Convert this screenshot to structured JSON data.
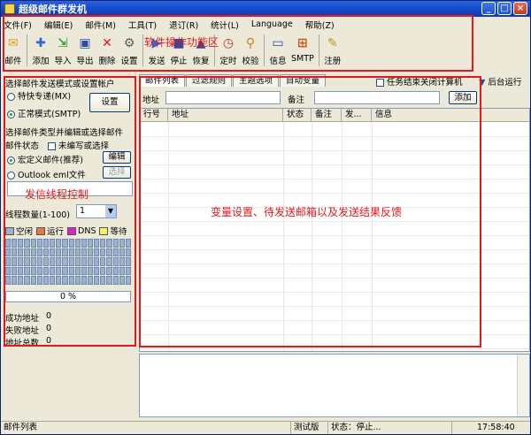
{
  "window": {
    "title": "超级邮件群发机"
  },
  "menu": [
    "文件(F)",
    "编辑(E)",
    "邮件(M)",
    "工具(T)",
    "退订(R)",
    "统计(L)",
    "Language",
    "帮助(Z)"
  ],
  "toolbar": {
    "mail": "邮件",
    "add": "添加",
    "import": "导入",
    "export": "导出",
    "delete": "删除",
    "settings": "设置",
    "send": "发送",
    "stop": "停止",
    "resume": "恢复",
    "schedule": "定时",
    "verify": "校验",
    "info": "信息",
    "smtp": "SMTP",
    "register": "注册",
    "annotation": "软件操作功能区"
  },
  "left": {
    "header": "选择邮件发送模式或设置帐户",
    "mode_fast": "特快专递(MX)",
    "mode_normal": "正常模式(SMTP)",
    "settings_btn": "设置",
    "type_header": "选择邮件类型并编辑或选择邮件",
    "mail_status": "邮件状态",
    "not_composed": "未编写或选择",
    "custom_mail": "宏定义邮件(推荐)",
    "edit_btn": "编辑",
    "outlook": "Outlook eml文件",
    "choose_btn": "选择",
    "annotation": "发信线程控制",
    "thread_label": "线程数量(1-100)",
    "thread_value": "1",
    "legend": [
      {
        "label": "空闲",
        "color": "#9bb1cf"
      },
      {
        "label": "运行",
        "color": "#e07b39"
      },
      {
        "label": "DNS",
        "color": "#e020d0"
      },
      {
        "label": "等待",
        "color": "#f2f25a"
      }
    ],
    "progress": "0 %",
    "success_label": "成功地址",
    "success_value": "0",
    "fail_label": "失败地址",
    "fail_value": "0",
    "total_label": "地址总数",
    "total_value": "0"
  },
  "right": {
    "tabs": [
      "邮件列表",
      "过滤规则",
      "主题选项",
      "自动变量"
    ],
    "close_on_finish": "任务结束关闭计算机",
    "background": "后台运行",
    "address_label": "地址",
    "remark_label": "备注",
    "add_btn": "添加",
    "columns": [
      "行号",
      "地址",
      "状态",
      "备注",
      "发...",
      "信息"
    ],
    "annotation": "变量设置、待发送邮箱以及发送结果反馈"
  },
  "statusbar": {
    "left": "邮件列表",
    "edition": "测试版",
    "state": "状态：停止...",
    "time": "17:58:40"
  },
  "colors": {
    "annotation": "#e3191c",
    "titlebar": "#1146c4"
  }
}
